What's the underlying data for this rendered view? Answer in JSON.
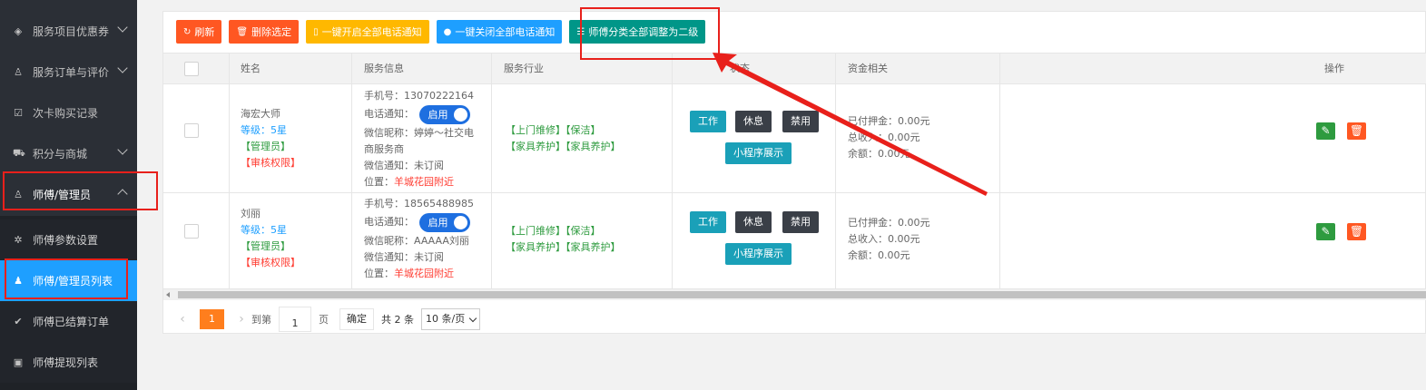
{
  "sidebar": {
    "items": [
      {
        "label": "服务项目优惠券",
        "icon": "tag-icon"
      },
      {
        "label": "服务订单与评价",
        "icon": "user-icon"
      },
      {
        "label": "次卡购买记录",
        "icon": "checkbox-icon"
      },
      {
        "label": "积分与商城",
        "icon": "cart-icon"
      },
      {
        "label": "师傅/管理员",
        "icon": "user-icon"
      }
    ],
    "subitems": [
      {
        "label": "师傅参数设置",
        "icon": "gear-icon"
      },
      {
        "label": "师傅/管理员列表",
        "icon": "user-list-icon"
      },
      {
        "label": "师傅已结算订单",
        "icon": "check-circle-icon"
      },
      {
        "label": "师傅提现列表",
        "icon": "money-icon"
      }
    ]
  },
  "toolbar": {
    "refresh": "刷新",
    "delete_selected": "删除选定",
    "enable_all_phone": "一键开启全部电话通知",
    "disable_all_phone": "一键关闭全部电话通知",
    "set_level_two": "师傅分类全部调整为二级"
  },
  "table": {
    "headers": [
      "姓名",
      "服务信息",
      "服务行业",
      "状态",
      "资金相关",
      "操作"
    ],
    "rows": [
      {
        "name": "海宏大师",
        "level": "等级：5星",
        "role": "【管理员】",
        "perm": "【审核权限】",
        "phone_label": "手机号：",
        "phone": "13070222164",
        "notify_label": "电话通知：",
        "switch": "启用",
        "wx_nick_label": "微信昵称：",
        "wx_nick": "婷婷～社交电商服务商",
        "wx_notify_label": "微信通知：",
        "wx_notify": "未订阅",
        "loc_label": "位置：",
        "loc": "羊城花园附近",
        "industry_line1": "【上门维修】【保洁】",
        "industry_line2": "【家具养护】【家具养护】",
        "btn_work": "工作",
        "btn_rest": "休息",
        "btn_ban": "禁用",
        "btn_mini": "小程序展示",
        "paid_deposit": "已付押金：0.00元",
        "income": "总收入：0.00元",
        "balance": "余额：0.00元"
      },
      {
        "name": "刘丽",
        "level": "等级：5星",
        "role": "【管理员】",
        "perm": "【审核权限】",
        "phone_label": "手机号：",
        "phone": "18565488985",
        "notify_label": "电话通知：",
        "switch": "启用",
        "wx_nick_label": "微信昵称：",
        "wx_nick": "AAAAA刘丽",
        "wx_notify_label": "微信通知：",
        "wx_notify": "未订阅",
        "loc_label": "位置：",
        "loc": "羊城花园附近",
        "industry_line1": "【上门维修】【保洁】",
        "industry_line2": "【家具养护】【家具养护】",
        "btn_work": "工作",
        "btn_rest": "休息",
        "btn_ban": "禁用",
        "btn_mini": "小程序展示",
        "paid_deposit": "已付押金：0.00元",
        "income": "总收入：0.00元",
        "balance": "余额：0.00元"
      }
    ]
  },
  "pager": {
    "current": "1",
    "goto_label": "到第",
    "page_value": "1",
    "page_label": "页",
    "go": "确定",
    "total": "共 2 条",
    "per_page": "10 条/页"
  },
  "colors": {
    "sidebar_bg": "#2b2f36",
    "active": "#1e9fff",
    "annotation": "#e8201b"
  }
}
